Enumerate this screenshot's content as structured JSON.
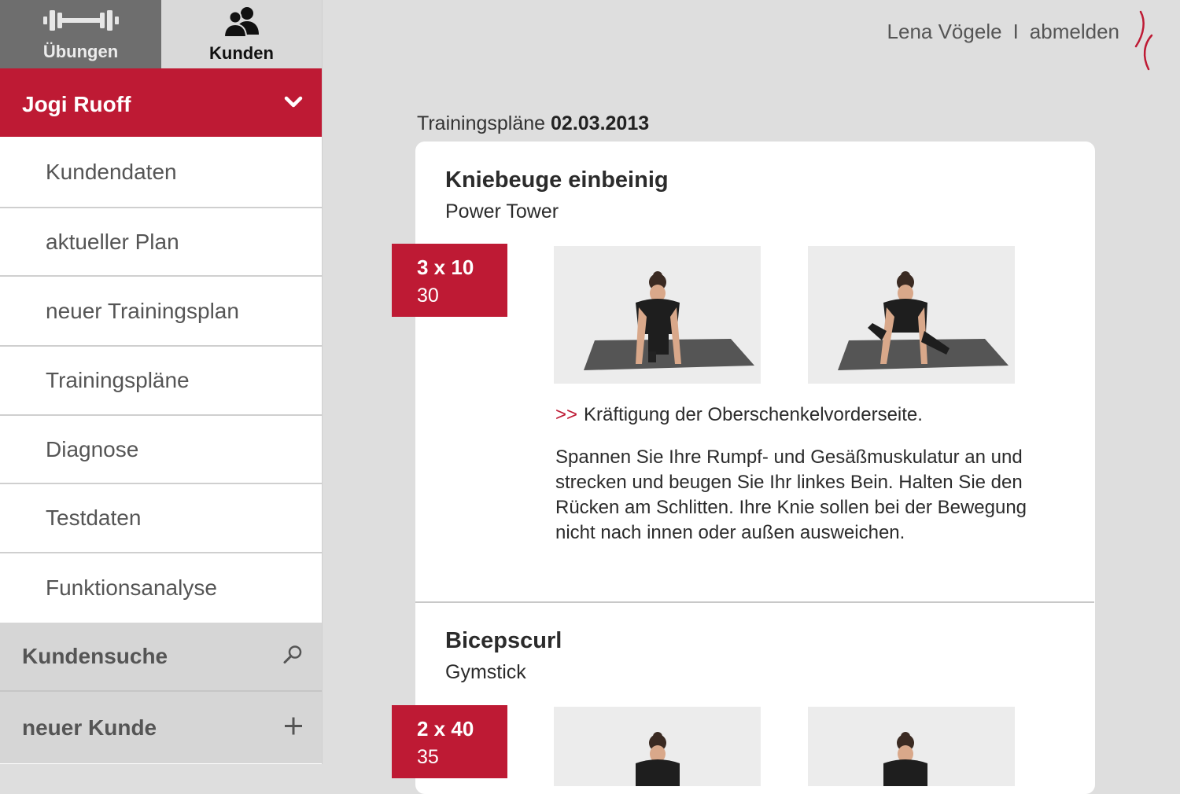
{
  "tabs": {
    "uebungen_label": "Übungen",
    "kunden_label": "Kunden"
  },
  "sidebar": {
    "client_name": "Jogi Ruoff",
    "items": [
      {
        "label": "Kundendaten"
      },
      {
        "label": "aktueller Plan"
      },
      {
        "label": "neuer Trainingsplan"
      },
      {
        "label": "Trainingspläne"
      },
      {
        "label": "Diagnose"
      },
      {
        "label": "Testdaten"
      },
      {
        "label": "Funktionsanalyse"
      }
    ],
    "search_label": "Kundensuche",
    "new_client_label": "neuer Kunde"
  },
  "header": {
    "user_name": "Lena Vögele",
    "separator": "I",
    "logout_label": "abmelden"
  },
  "main": {
    "title_prefix": "Trainingspläne",
    "title_date": "02.03.2013",
    "exercises": [
      {
        "name": "Kniebeuge einbeinig",
        "device": "Power Tower",
        "sets": "3 x 10",
        "weight": "30",
        "goal_marker": ">>",
        "goal": "Kräftigung der Oberschenkelvorderseite.",
        "description": "Spannen Sie Ihre Rumpf- und Gesäßmuskulatur an und strecken und beugen Sie Ihr linkes Bein. Halten Sie den Rücken am Schlitten. Ihre Knie sollen bei der Bewegung nicht nach innen oder außen ausweichen."
      },
      {
        "name": "Bicepscurl",
        "device": "Gymstick",
        "sets": "2 x 40",
        "weight": "35"
      }
    ]
  },
  "colors": {
    "accent": "#be1a34",
    "background": "#dedede",
    "tab_inactive": "#6e6e6e",
    "tab_active": "#d9d9d9"
  },
  "icons": {
    "uebungen_tab": "dumbbell-icon",
    "kunden_tab": "users-icon",
    "client_toggle": "chevron-down-icon",
    "search": "search-icon",
    "add": "plus-icon",
    "logo": "logo-icon"
  }
}
